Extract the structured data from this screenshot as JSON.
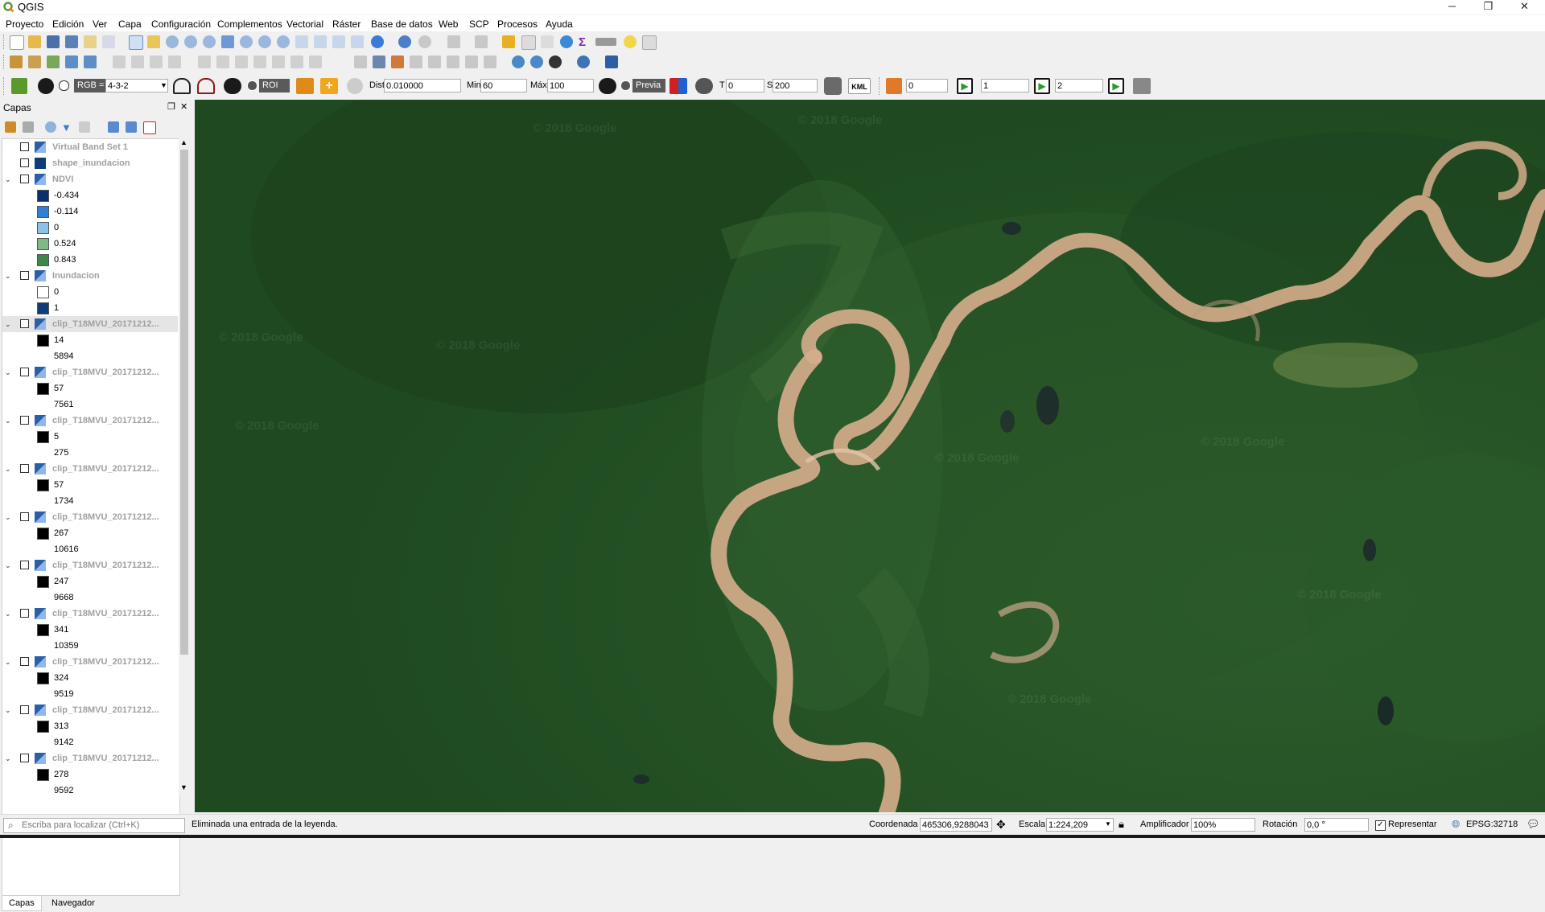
{
  "window": {
    "title": "QGIS",
    "minimize": "─",
    "maximize": "❐",
    "close": "✕"
  },
  "menu": [
    "Proyecto",
    "Edición",
    "Ver",
    "Capa",
    "Configuración",
    "Complementos",
    "Vectorial",
    "Ráster",
    "Base de datos",
    "Web",
    "SCP",
    "Procesos",
    "Ayuda"
  ],
  "scp_toolbar": {
    "rgb_label": "RGB =",
    "rgb_value": "4-3-2",
    "roi_label": "ROI",
    "dist_label": "Dist",
    "dist_value": "0.010000",
    "min_label": "Min",
    "min_value": "60",
    "max_label": "Máx",
    "max_value": "100",
    "preview_label": "Previa",
    "t_label": "T",
    "t_value": "0",
    "s_label": "S",
    "s_value": "200",
    "kml_label": "KML",
    "band_values": [
      "0",
      "1",
      "2"
    ]
  },
  "layers_panel": {
    "title": "Capas",
    "items": [
      {
        "kind": "layer",
        "name": "Virtual Band Set 1",
        "expanded": false
      },
      {
        "kind": "layer",
        "name": "shape_inundacion",
        "expanded": false,
        "swatch": "#0f3d7a"
      },
      {
        "kind": "layer",
        "name": "NDVI",
        "expanded": true
      },
      {
        "kind": "legend",
        "value": "-0.434",
        "color": "#0b2e6e"
      },
      {
        "kind": "legend",
        "value": "-0.114",
        "color": "#2f7fd6"
      },
      {
        "kind": "legend",
        "value": "0",
        "color": "#89c2ec"
      },
      {
        "kind": "legend",
        "value": "0.524",
        "color": "#7dbb84"
      },
      {
        "kind": "legend",
        "value": "0.843",
        "color": "#3a8a47"
      },
      {
        "kind": "layer",
        "name": "Inundacion",
        "expanded": true
      },
      {
        "kind": "legend",
        "value": "0",
        "color": "#ffffff"
      },
      {
        "kind": "legend",
        "value": "1",
        "color": "#0f3d7a"
      },
      {
        "kind": "layer",
        "name": "clip_T18MVU_20171212...",
        "expanded": true,
        "selected": true
      },
      {
        "kind": "legend",
        "value": "14",
        "color": "#000000"
      },
      {
        "kind": "legend",
        "value": "5894",
        "color": null
      },
      {
        "kind": "layer",
        "name": "clip_T18MVU_20171212...",
        "expanded": true
      },
      {
        "kind": "legend",
        "value": "57",
        "color": "#000000"
      },
      {
        "kind": "legend",
        "value": "7561",
        "color": null
      },
      {
        "kind": "layer",
        "name": "clip_T18MVU_20171212...",
        "expanded": true
      },
      {
        "kind": "legend",
        "value": "5",
        "color": "#000000"
      },
      {
        "kind": "legend",
        "value": "275",
        "color": null
      },
      {
        "kind": "layer",
        "name": "clip_T18MVU_20171212...",
        "expanded": true
      },
      {
        "kind": "legend",
        "value": "57",
        "color": "#000000"
      },
      {
        "kind": "legend",
        "value": "1734",
        "color": null
      },
      {
        "kind": "layer",
        "name": "clip_T18MVU_20171212...",
        "expanded": true
      },
      {
        "kind": "legend",
        "value": "267",
        "color": "#000000"
      },
      {
        "kind": "legend",
        "value": "10616",
        "color": null
      },
      {
        "kind": "layer",
        "name": "clip_T18MVU_20171212...",
        "expanded": true
      },
      {
        "kind": "legend",
        "value": "247",
        "color": "#000000"
      },
      {
        "kind": "legend",
        "value": "9668",
        "color": null
      },
      {
        "kind": "layer",
        "name": "clip_T18MVU_20171212...",
        "expanded": true
      },
      {
        "kind": "legend",
        "value": "341",
        "color": "#000000"
      },
      {
        "kind": "legend",
        "value": "10359",
        "color": null
      },
      {
        "kind": "layer",
        "name": "clip_T18MVU_20171212...",
        "expanded": true
      },
      {
        "kind": "legend",
        "value": "324",
        "color": "#000000"
      },
      {
        "kind": "legend",
        "value": "9519",
        "color": null
      },
      {
        "kind": "layer",
        "name": "clip_T18MVU_20171212...",
        "expanded": true
      },
      {
        "kind": "legend",
        "value": "313",
        "color": "#000000"
      },
      {
        "kind": "legend",
        "value": "9142",
        "color": null
      },
      {
        "kind": "layer",
        "name": "clip_T18MVU_20171212...",
        "expanded": true
      },
      {
        "kind": "legend",
        "value": "278",
        "color": "#000000"
      },
      {
        "kind": "legend",
        "value": "9592",
        "color": null
      }
    ],
    "tabs": [
      "Capas",
      "Navegador"
    ]
  },
  "map": {
    "watermark": "© 2018 Google"
  },
  "status": {
    "search_placeholder": "Escriba para localizar (Ctrl+K)",
    "message": "Eliminada una entrada de la leyenda.",
    "coord_label": "Coordenada",
    "coord_value": "465306,9288043",
    "scale_label": "Escala",
    "scale_value": "1:224,209",
    "magnifier_label": "Amplificador",
    "magnifier_value": "100%",
    "rotation_label": "Rotación",
    "rotation_value": "0,0 °",
    "render_label": "Representar",
    "crs": "EPSG:32718"
  },
  "colors": {
    "accent": "#589632",
    "water": "#d5ab8b",
    "forest": "#1f4a20"
  }
}
